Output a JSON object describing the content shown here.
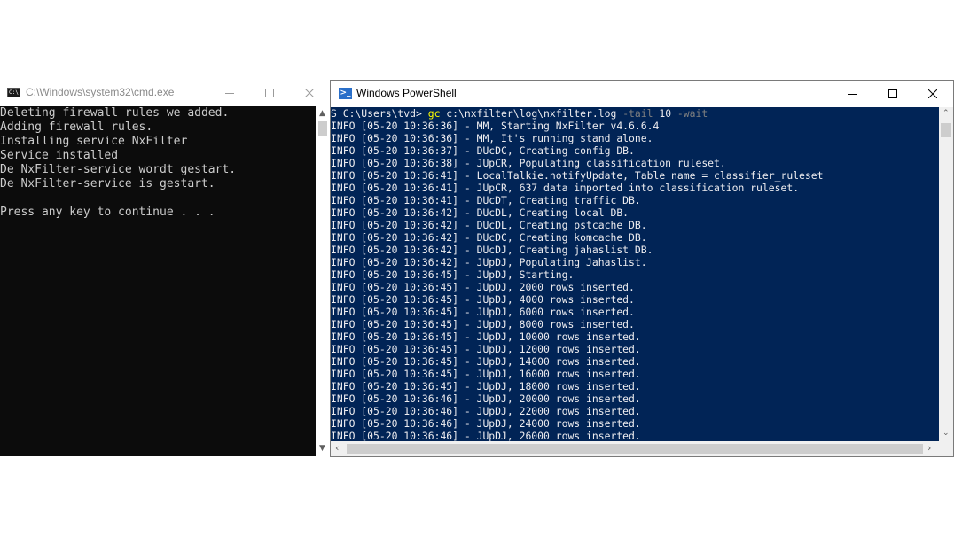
{
  "cmd": {
    "title": "C:\\Windows\\system32\\cmd.exe",
    "icon": "cmd-icon",
    "lines": [
      "Deleting firewall rules we added.",
      "Adding firewall rules.",
      "Installing service NxFilter",
      "Service installed",
      "De NxFilter-service wordt gestart.",
      "De NxFilter-service is gestart.",
      "",
      "Press any key to continue . . ."
    ],
    "colors": {
      "background": "#0c0c0c",
      "text": "#cccccc"
    }
  },
  "powershell": {
    "title": "Windows PowerShell",
    "icon": "powershell-icon",
    "prompt": {
      "path": "S C:\\Users\\tvd> ",
      "command": "gc",
      "arguments": " c:\\nxfilter\\log\\nxfilter.log ",
      "param1": "-tail",
      "value1": " 10 ",
      "param2": "-wait"
    },
    "lines": [
      "INFO [05-20 10:36:36] - MM, Starting NxFilter v4.6.6.4",
      "INFO [05-20 10:36:36] - MM, It's running stand alone.",
      "INFO [05-20 10:36:37] - DUcDC, Creating config DB.",
      "INFO [05-20 10:36:38] - JUpCR, Populating classification ruleset.",
      "INFO [05-20 10:36:41] - LocalTalkie.notifyUpdate, Table name = classifier_ruleset",
      "INFO [05-20 10:36:41] - JUpCR, 637 data imported into classification ruleset.",
      "INFO [05-20 10:36:41] - DUcDT, Creating traffic DB.",
      "INFO [05-20 10:36:42] - DUcDL, Creating local DB.",
      "INFO [05-20 10:36:42] - DUcDL, Creating pstcache DB.",
      "INFO [05-20 10:36:42] - DUcDC, Creating komcache DB.",
      "INFO [05-20 10:36:42] - DUcDJ, Creating jahaslist DB.",
      "INFO [05-20 10:36:42] - JUpDJ, Populating Jahaslist.",
      "INFO [05-20 10:36:45] - JUpDJ, Starting.",
      "INFO [05-20 10:36:45] - JUpDJ, 2000 rows inserted.",
      "INFO [05-20 10:36:45] - JUpDJ, 4000 rows inserted.",
      "INFO [05-20 10:36:45] - JUpDJ, 6000 rows inserted.",
      "INFO [05-20 10:36:45] - JUpDJ, 8000 rows inserted.",
      "INFO [05-20 10:36:45] - JUpDJ, 10000 rows inserted.",
      "INFO [05-20 10:36:45] - JUpDJ, 12000 rows inserted.",
      "INFO [05-20 10:36:45] - JUpDJ, 14000 rows inserted.",
      "INFO [05-20 10:36:45] - JUpDJ, 16000 rows inserted.",
      "INFO [05-20 10:36:45] - JUpDJ, 18000 rows inserted.",
      "INFO [05-20 10:36:46] - JUpDJ, 20000 rows inserted.",
      "INFO [05-20 10:36:46] - JUpDJ, 22000 rows inserted.",
      "INFO [05-20 10:36:46] - JUpDJ, 24000 rows inserted.",
      "INFO [05-20 10:36:46] - JUpDJ, 26000 rows inserted."
    ],
    "colors": {
      "background": "#012456",
      "text": "#eeedf0",
      "command": "#ffff00",
      "parameter": "#808080"
    }
  },
  "caption_buttons": {
    "minimize_icon": "minimize-icon",
    "maximize_icon": "maximize-icon",
    "close_icon": "close-icon"
  }
}
